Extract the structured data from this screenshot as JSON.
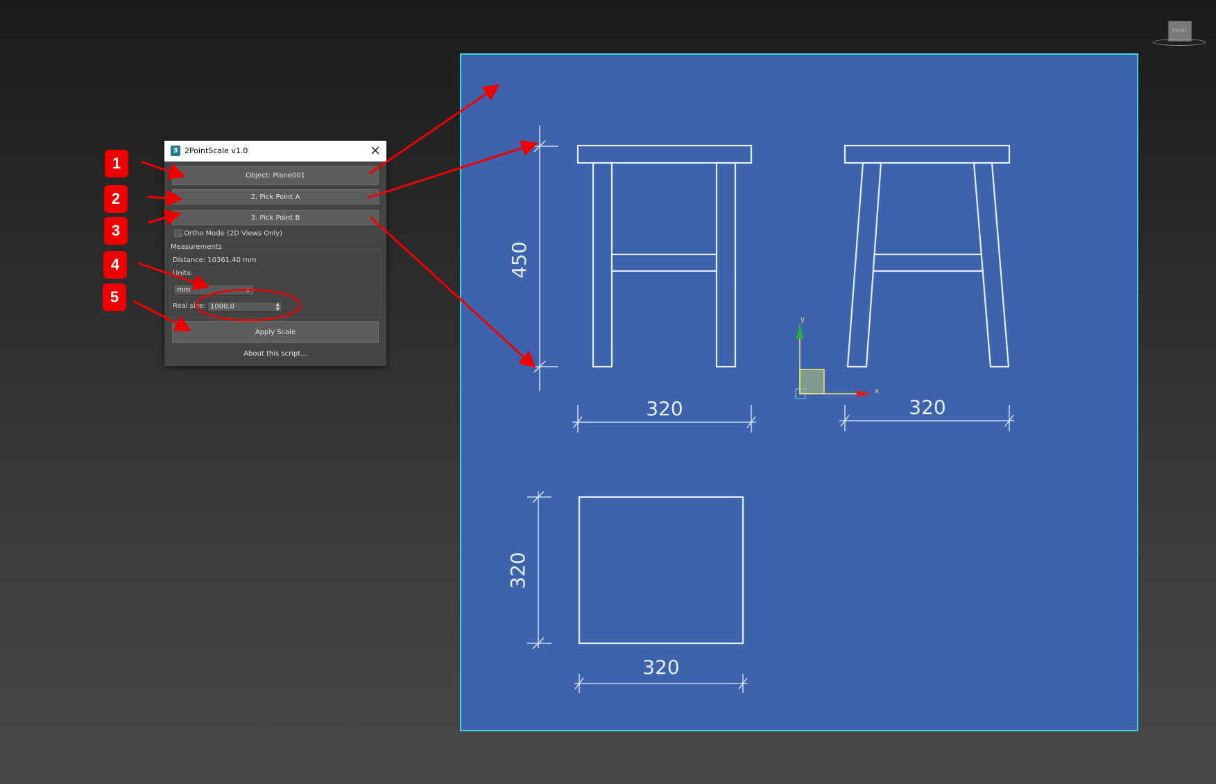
{
  "dialog": {
    "title": "2PointScale v1.0",
    "app_icon_glyph": "3",
    "object_button": "Object: Plane001",
    "pick_a_button": "2. Pick Point A",
    "pick_b_button": "3. Pick Point B",
    "ortho_label": "Ortho Mode (2D Views Only)",
    "ortho_checked": false,
    "measurements_label": "Measurements",
    "distance_text": "Distance: 10361.40 mm",
    "units_label": "Units:",
    "units_value": "mm",
    "real_size_label": "Real size:",
    "real_size_value": "1000,0",
    "apply_button": "Apply Scale",
    "about_link": "About this script..."
  },
  "annotations": {
    "steps": [
      "1",
      "2",
      "3",
      "4",
      "5"
    ],
    "color": "#ee0000"
  },
  "drawing": {
    "dim_front_height": "450",
    "dim_front_width": "320",
    "dim_side_width": "320",
    "dim_top_height": "320",
    "dim_top_width": "320",
    "background_color": "#3d63ad",
    "line_color": "#e6eefc"
  },
  "gizmo": {
    "x_label": "x",
    "y_label": "y"
  },
  "viewcube": {
    "label": "FRONT"
  }
}
